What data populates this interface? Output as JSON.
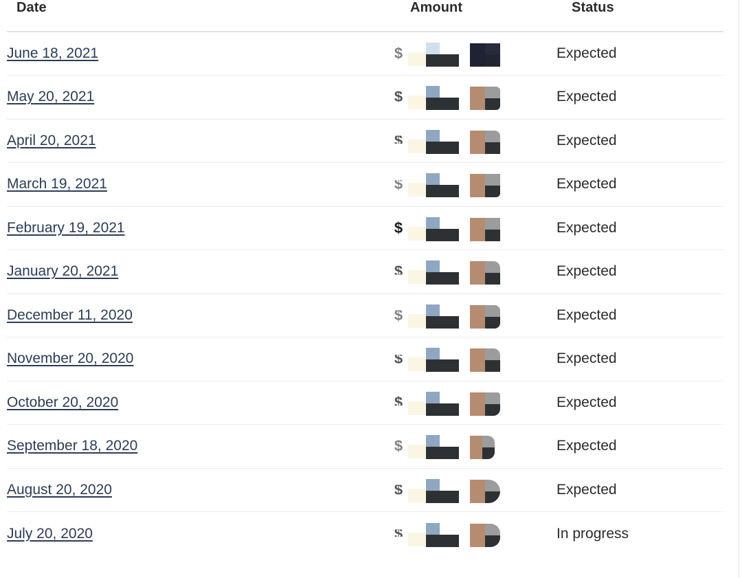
{
  "table": {
    "name": "payments-history-table",
    "columns": [
      {
        "key": "date",
        "label": "Date",
        "align": "left"
      },
      {
        "key": "amount",
        "label": "Amount",
        "align": "left"
      },
      {
        "key": "status",
        "label": "Status",
        "align": "left"
      }
    ],
    "rows": [
      {
        "date": "June 18, 2021",
        "amount_currency": "$",
        "amount": "",
        "amount_redacted": true,
        "status": "Expected"
      },
      {
        "date": "May 20, 2021",
        "amount_currency": "$",
        "amount": "",
        "amount_redacted": true,
        "status": "Expected"
      },
      {
        "date": "April 20, 2021",
        "amount_currency": "$",
        "amount": "",
        "amount_redacted": true,
        "status": "Expected"
      },
      {
        "date": "March 19, 2021",
        "amount_currency": "$",
        "amount": "",
        "amount_redacted": true,
        "status": "Expected"
      },
      {
        "date": "February 19, 2021",
        "amount_currency": "$",
        "amount": "",
        "amount_redacted": true,
        "status": "Expected"
      },
      {
        "date": "January 20, 2021",
        "amount_currency": "$",
        "amount": "",
        "amount_redacted": true,
        "status": "Expected"
      },
      {
        "date": "December 11, 2020",
        "amount_currency": "$",
        "amount": "",
        "amount_redacted": true,
        "status": "Expected"
      },
      {
        "date": "November 20, 2020",
        "amount_currency": "$",
        "amount": "",
        "amount_redacted": true,
        "status": "Expected"
      },
      {
        "date": "October 20, 2020",
        "amount_currency": "$",
        "amount": "",
        "amount_redacted": true,
        "status": "Expected"
      },
      {
        "date": "September 18, 2020",
        "amount_currency": "$",
        "amount": "",
        "amount_redacted": true,
        "status": "Expected"
      },
      {
        "date": "August 20, 2020",
        "amount_currency": "$",
        "amount": "",
        "amount_redacted": true,
        "status": "Expected"
      },
      {
        "date": "July 20, 2020",
        "amount_currency": "$",
        "amount": "",
        "amount_redacted": true,
        "status": "In progress"
      }
    ]
  },
  "colors": {
    "page_background": "#ffffff",
    "header_text": "#2b2b2b",
    "link_text": "#2c3c56",
    "body_text": "#2b2b2b",
    "header_rule": "#e2e2e2",
    "row_rule": "#ededed",
    "redaction_cream": "#fbf6e4",
    "redaction_blue": "#8fa7c0",
    "redaction_dark": "#2e3133",
    "redaction_tan": "#b58b72",
    "redaction_gray": "#9c9c9c"
  }
}
